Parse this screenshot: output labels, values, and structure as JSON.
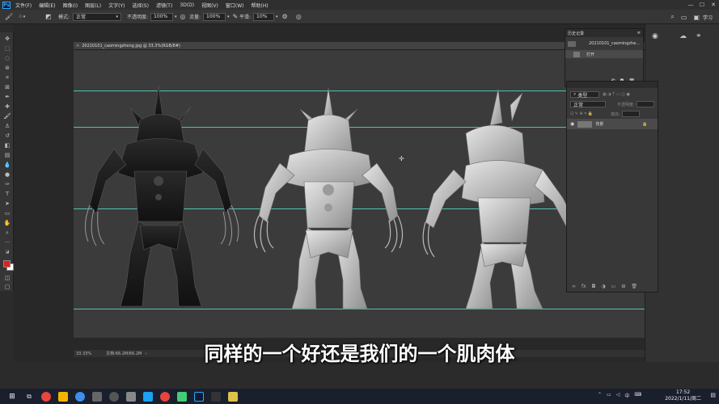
{
  "menubar": {
    "items": [
      "文件(F)",
      "编辑(E)",
      "图像(I)",
      "图层(L)",
      "文字(Y)",
      "选择(S)",
      "滤镜(T)",
      "3D(D)",
      "视图(V)",
      "窗口(W)",
      "帮助(H)"
    ]
  },
  "options": {
    "mode_label": "模式:",
    "mode_value": "正常",
    "opacity_label": "不透明度:",
    "opacity_value": "100%",
    "flow_label": "流量:",
    "flow_value": "100%",
    "smooth_label": "平滑:",
    "smooth_value": "10%",
    "share": "学习"
  },
  "document": {
    "tab_title": "20210101_caomingzheng.jpg @ 33.3%(RGB/8#)",
    "zoom": "33.33%",
    "doc_info": "文档:66.2M/66.2M"
  },
  "history": {
    "tab": "历史记录",
    "snapshot": "20210101_caomingzhe...",
    "step": "打开"
  },
  "layers": {
    "search_placeholder": "类型",
    "blend_mode": "正常",
    "opacity_label": "不透明度:",
    "fill_label": "填充:",
    "layer_name": "背景"
  },
  "subtitle": "同样的一个好还是我们的一个肌肉体",
  "canvas_tray": {
    "lang": "EN"
  },
  "taskbar": {
    "time": "17:52",
    "date": "2022/1/11/周二",
    "lang": "中"
  },
  "colors": {
    "guide": "#4fc2b6",
    "foreground": "#e0201a",
    "background": "#ffffff"
  }
}
